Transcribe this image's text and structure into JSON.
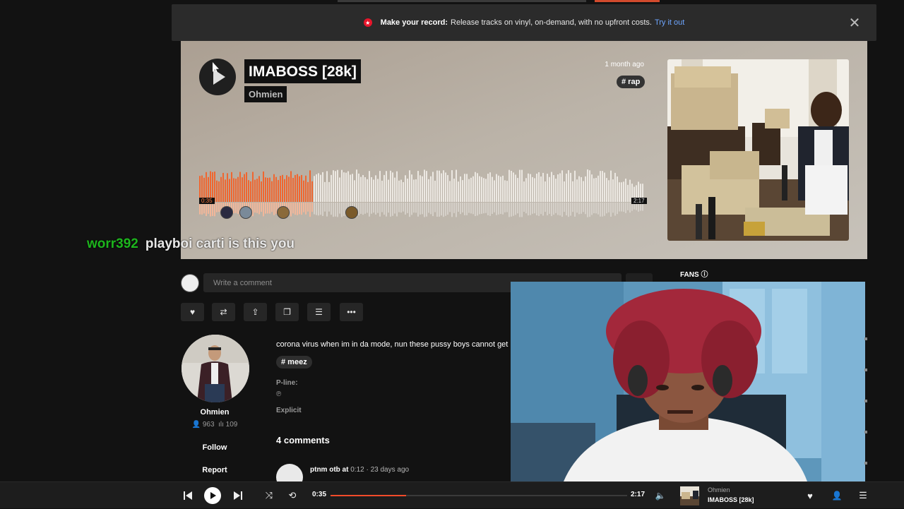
{
  "banner": {
    "bold": "Make your record:",
    "text": "Release tracks on vinyl, on-demand, with no upfront costs.",
    "link": "Try it out",
    "close_icon": "close-icon"
  },
  "track": {
    "title": "IMABOSS [28k]",
    "artist": "Ohmien",
    "age": "1 month ago",
    "genre": "# rap",
    "current_time": "0:35",
    "total_time": "2:17",
    "progress": 0.255
  },
  "chat": {
    "user": "worr392",
    "message": "playboi carti is this you"
  },
  "comment_box": {
    "placeholder": "Write a comment"
  },
  "actions": [
    "heart-icon",
    "repost-icon",
    "share-icon",
    "copy-icon",
    "add-to-playlist-icon",
    "more-icon"
  ],
  "fans": {
    "label": "FANS"
  },
  "profile": {
    "name": "Ohmien",
    "followers": "963",
    "tracks": "109",
    "follow": "Follow",
    "report": "Report"
  },
  "details": {
    "description": "corona virus when im in da mode, nun these pussy boys cannot get",
    "tag": "# meez",
    "pline_label": "P-line:",
    "pline_value": "℗",
    "explicit": "Explicit",
    "comments_count": "4 comments"
  },
  "latest_comment": {
    "user": "ptnm otb",
    "at": "at",
    "timestamp": "0:12",
    "age": "· 23 days ago"
  },
  "player": {
    "current_time": "0:35",
    "total_time": "2:17",
    "artist": "Ohmien",
    "title": "IMABOSS [28k]"
  },
  "colors": {
    "accent": "#f24b2a",
    "chat_user": "#1db51d",
    "link": "#6ea6ff"
  }
}
